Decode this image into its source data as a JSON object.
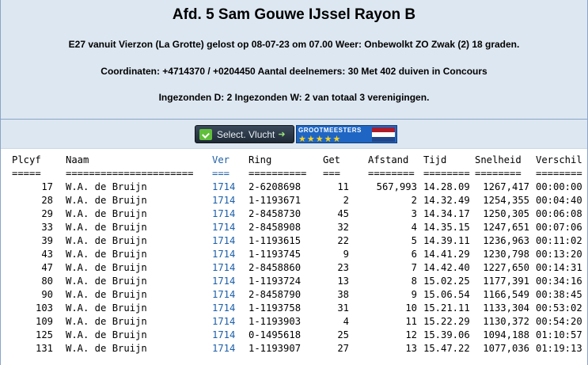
{
  "header": {
    "title": "Afd. 5 Sam Gouwe IJssel Rayon B",
    "line1": "E27 vanuit Vierzon (La Grotte) gelost op 08-07-23 om 07.00 Weer: Onbewolkt ZO Zwak (2) 18 graden.",
    "line2": "Coordinaten: +4714370 / +0204450 Aantal deelnemers: 30 Met 402 duiven in Concours",
    "line3": "Ingezonden D: 2 Ingezonden W: 2 van totaal 3 verenigingen."
  },
  "toolbar": {
    "select_label": "Select. Vlucht",
    "select_arrow": "➜",
    "grootmeesters_label": "GROOTMEESTERS",
    "stars": "★★★★★"
  },
  "colors": {
    "flag_red": "#ae1c28",
    "flag_white": "#ffffff",
    "flag_blue": "#21468b",
    "ver_blue": "#1c5fa8"
  },
  "table": {
    "columns": [
      "Plcyf",
      "Naam",
      "Ver",
      "Ring",
      "Get",
      "Afstand",
      "Tijd",
      "Snelheid",
      "Verschil"
    ],
    "underline": [
      "=====",
      "======================",
      "===",
      "==========",
      "===",
      "========",
      "========",
      "========",
      "========"
    ],
    "rows": [
      [
        "17",
        "W.A. de Bruijn",
        "1714",
        "2-6208698",
        "11",
        "567,993",
        "14.28.09",
        "1267,417",
        "00:00:00"
      ],
      [
        "28",
        "W.A. de Bruijn",
        "1714",
        "1-1193671",
        "2",
        "2",
        "14.32.49",
        "1254,355",
        "00:04:40"
      ],
      [
        "29",
        "W.A. de Bruijn",
        "1714",
        "2-8458730",
        "45",
        "3",
        "14.34.17",
        "1250,305",
        "00:06:08"
      ],
      [
        "33",
        "W.A. de Bruijn",
        "1714",
        "2-8458908",
        "32",
        "4",
        "14.35.15",
        "1247,651",
        "00:07:06"
      ],
      [
        "39",
        "W.A. de Bruijn",
        "1714",
        "1-1193615",
        "22",
        "5",
        "14.39.11",
        "1236,963",
        "00:11:02"
      ],
      [
        "43",
        "W.A. de Bruijn",
        "1714",
        "1-1193745",
        "9",
        "6",
        "14.41.29",
        "1230,798",
        "00:13:20"
      ],
      [
        "47",
        "W.A. de Bruijn",
        "1714",
        "2-8458860",
        "23",
        "7",
        "14.42.40",
        "1227,650",
        "00:14:31"
      ],
      [
        "80",
        "W.A. de Bruijn",
        "1714",
        "1-1193724",
        "13",
        "8",
        "15.02.25",
        "1177,391",
        "00:34:16"
      ],
      [
        "90",
        "W.A. de Bruijn",
        "1714",
        "2-8458790",
        "38",
        "9",
        "15.06.54",
        "1166,549",
        "00:38:45"
      ],
      [
        "103",
        "W.A. de Bruijn",
        "1714",
        "1-1193758",
        "31",
        "10",
        "15.21.11",
        "1133,304",
        "00:53:02"
      ],
      [
        "109",
        "W.A. de Bruijn",
        "1714",
        "1-1193903",
        "4",
        "11",
        "15.22.29",
        "1130,372",
        "00:54:20"
      ],
      [
        "125",
        "W.A. de Bruijn",
        "1714",
        "0-1495618",
        "25",
        "12",
        "15.39.06",
        "1094,188",
        "01:10:57"
      ],
      [
        "131",
        "W.A. de Bruijn",
        "1714",
        "1-1193907",
        "27",
        "13",
        "15.47.22",
        "1077,036",
        "01:19:13"
      ]
    ]
  }
}
